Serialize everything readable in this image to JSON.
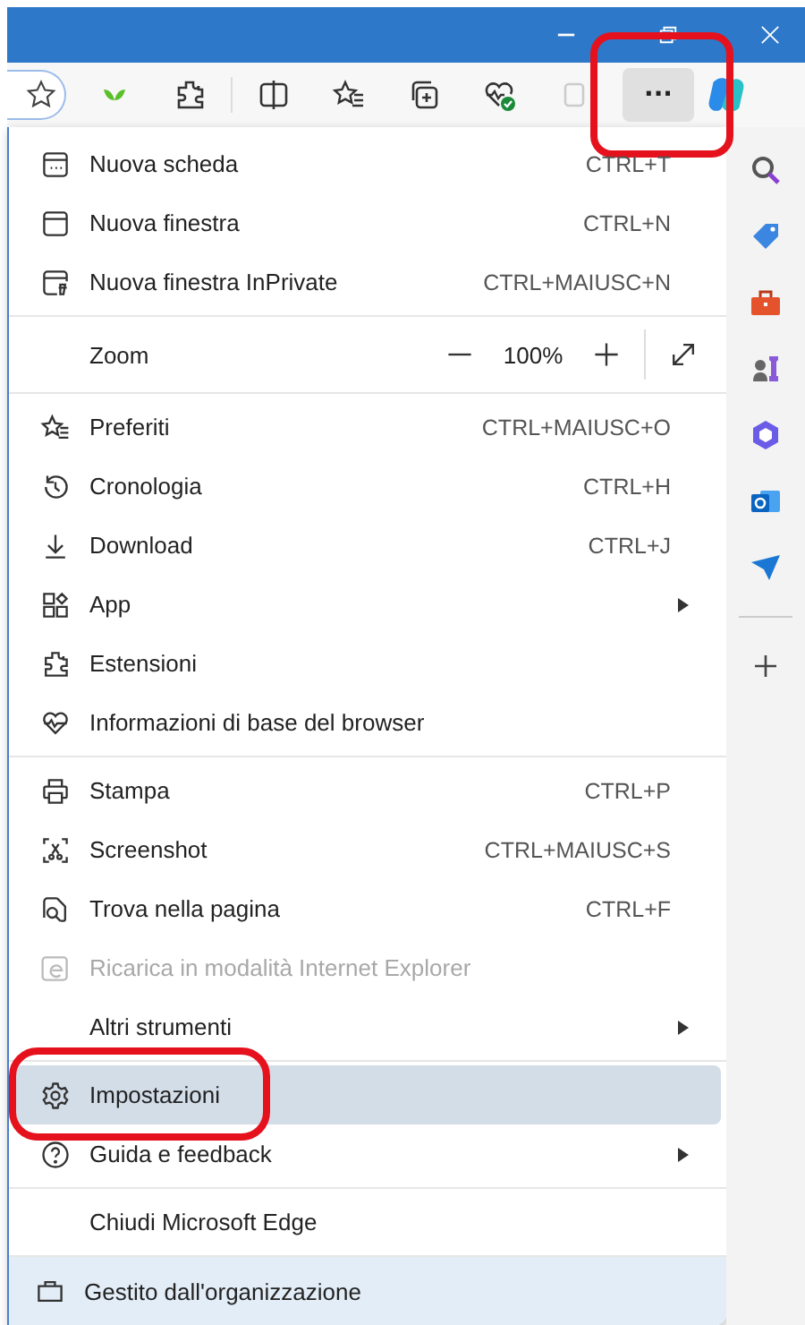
{
  "toolbar": {
    "more_button": {
      "label": "···",
      "selected": true,
      "annotated": true
    }
  },
  "menu": {
    "sections": [
      {
        "kind": "items",
        "items": [
          {
            "label": "Nuova scheda",
            "shortcut": "CTRL+T",
            "submenu": false,
            "disabled": false,
            "selected": false,
            "annotated": false
          },
          {
            "label": "Nuova finestra",
            "shortcut": "CTRL+N",
            "submenu": false,
            "disabled": false,
            "selected": false,
            "annotated": false
          },
          {
            "label": "Nuova finestra InPrivate",
            "shortcut": "CTRL+MAIUSC+N",
            "submenu": false,
            "disabled": false,
            "selected": false,
            "annotated": false
          }
        ]
      },
      {
        "kind": "zoom",
        "label": "Zoom",
        "value": "100%"
      },
      {
        "kind": "items",
        "items": [
          {
            "label": "Preferiti",
            "shortcut": "CTRL+MAIUSC+O",
            "submenu": false,
            "disabled": false,
            "selected": false,
            "annotated": false
          },
          {
            "label": "Cronologia",
            "shortcut": "CTRL+H",
            "submenu": false,
            "disabled": false,
            "selected": false,
            "annotated": false
          },
          {
            "label": "Download",
            "shortcut": "CTRL+J",
            "submenu": false,
            "disabled": false,
            "selected": false,
            "annotated": false
          },
          {
            "label": "App",
            "submenu": true,
            "disabled": false,
            "selected": false,
            "annotated": false
          },
          {
            "label": "Estensioni",
            "submenu": false,
            "disabled": false,
            "selected": false,
            "annotated": false
          },
          {
            "label": "Informazioni di base del browser",
            "submenu": false,
            "disabled": false,
            "selected": false,
            "annotated": false
          }
        ]
      },
      {
        "kind": "items",
        "items": [
          {
            "label": "Stampa",
            "shortcut": "CTRL+P",
            "submenu": false,
            "disabled": false,
            "selected": false,
            "annotated": false
          },
          {
            "label": "Screenshot",
            "shortcut": "CTRL+MAIUSC+S",
            "submenu": false,
            "disabled": false,
            "selected": false,
            "annotated": false
          },
          {
            "label": "Trova nella pagina",
            "shortcut": "CTRL+F",
            "submenu": false,
            "disabled": false,
            "selected": false,
            "annotated": false
          },
          {
            "label": "Ricarica in modalità Internet Explorer",
            "submenu": false,
            "disabled": true,
            "selected": false,
            "annotated": false
          },
          {
            "label": "Altri strumenti",
            "submenu": true,
            "disabled": false,
            "selected": false,
            "annotated": false
          }
        ]
      },
      {
        "kind": "items",
        "items": [
          {
            "label": "Impostazioni",
            "submenu": false,
            "disabled": false,
            "selected": true,
            "annotated": true
          },
          {
            "label": "Guida e feedback",
            "submenu": true,
            "disabled": false,
            "selected": false,
            "annotated": false
          }
        ]
      },
      {
        "kind": "items",
        "items": [
          {
            "label": "Chiudi Microsoft Edge",
            "submenu": false,
            "disabled": false,
            "selected": false,
            "annotated": false
          }
        ]
      },
      {
        "kind": "footer",
        "label": "Gestito dall'organizzazione"
      }
    ]
  }
}
